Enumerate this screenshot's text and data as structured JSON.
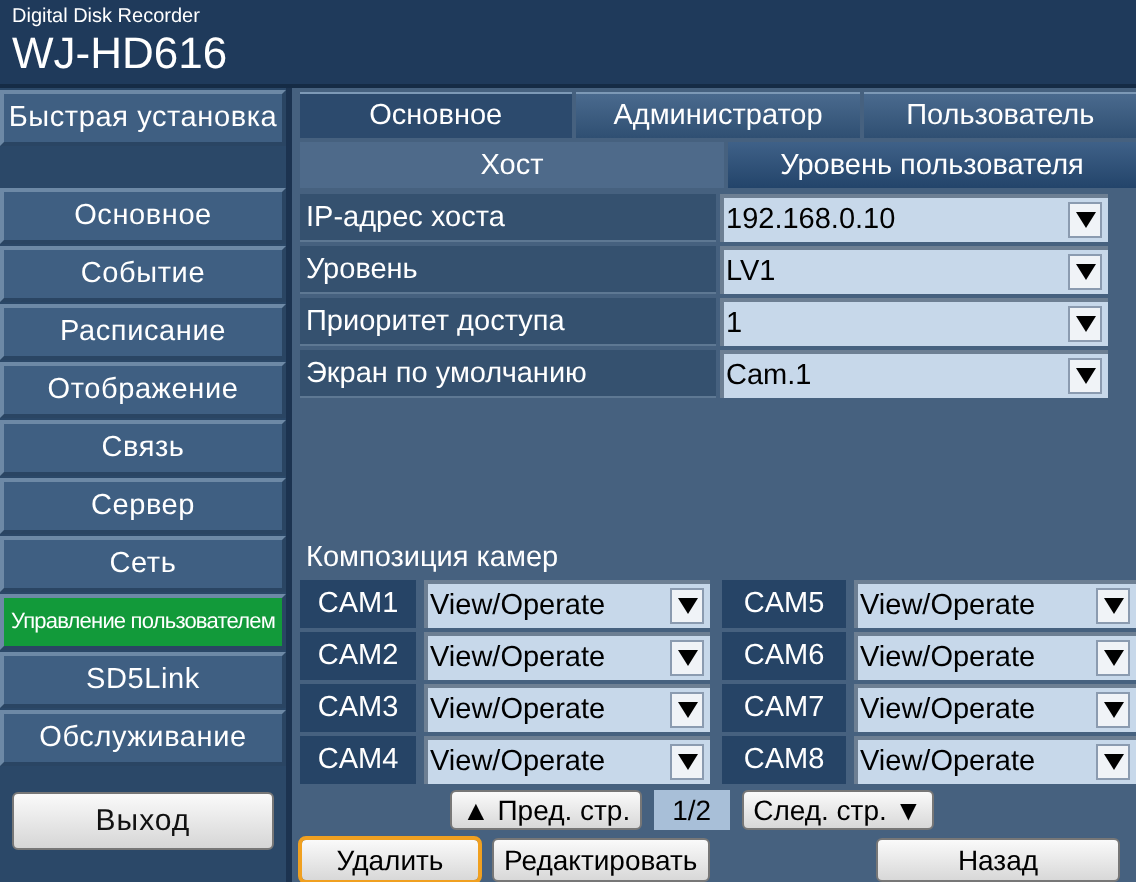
{
  "header": {
    "subtitle": "Digital Disk Recorder",
    "model": "WJ-HD616"
  },
  "sidebar": {
    "quick": "Быстрая установка",
    "items": [
      {
        "label": "Основное",
        "selected": false
      },
      {
        "label": "Событие",
        "selected": false
      },
      {
        "label": "Расписание",
        "selected": false
      },
      {
        "label": "Отображение",
        "selected": false
      },
      {
        "label": "Связь",
        "selected": false
      },
      {
        "label": "Сервер",
        "selected": false
      },
      {
        "label": "Сеть",
        "selected": false
      },
      {
        "label": "Управление пользователем",
        "selected": true
      },
      {
        "label": "SD5Link",
        "selected": false
      },
      {
        "label": "Обслуживание",
        "selected": false
      }
    ],
    "exit": "Выход"
  },
  "tabs": [
    {
      "label": "Основное",
      "selected": true
    },
    {
      "label": "Администратор",
      "selected": false
    },
    {
      "label": "Пользователь",
      "selected": false
    }
  ],
  "subtabs": [
    {
      "label": "Хост",
      "selected": true
    },
    {
      "label": "Уровень пользователя",
      "selected": false
    }
  ],
  "settings": [
    {
      "label": "IP-адрес хоста",
      "value": "192.168.0.10"
    },
    {
      "label": "Уровень",
      "value": "LV1"
    },
    {
      "label": "Приоритет доступа",
      "value": "1"
    },
    {
      "label": "Экран по умолчанию",
      "value": "Cam.1"
    }
  ],
  "cameras": {
    "title": "Композиция камер",
    "items": [
      {
        "name": "CAM1",
        "value": "View/Operate"
      },
      {
        "name": "CAM5",
        "value": "View/Operate"
      },
      {
        "name": "CAM2",
        "value": "View/Operate"
      },
      {
        "name": "CAM6",
        "value": "View/Operate"
      },
      {
        "name": "CAM3",
        "value": "View/Operate"
      },
      {
        "name": "CAM7",
        "value": "View/Operate"
      },
      {
        "name": "CAM4",
        "value": "View/Operate"
      },
      {
        "name": "CAM8",
        "value": "View/Operate"
      }
    ]
  },
  "pager": {
    "prev": "▲ Пред. стр.",
    "page": "1/2",
    "next": "След. стр. ▼"
  },
  "buttons": [
    {
      "label": "Удалить",
      "selected": true
    },
    {
      "label": "Редактировать",
      "selected": false
    },
    {
      "label": "Назад",
      "selected": false
    }
  ]
}
